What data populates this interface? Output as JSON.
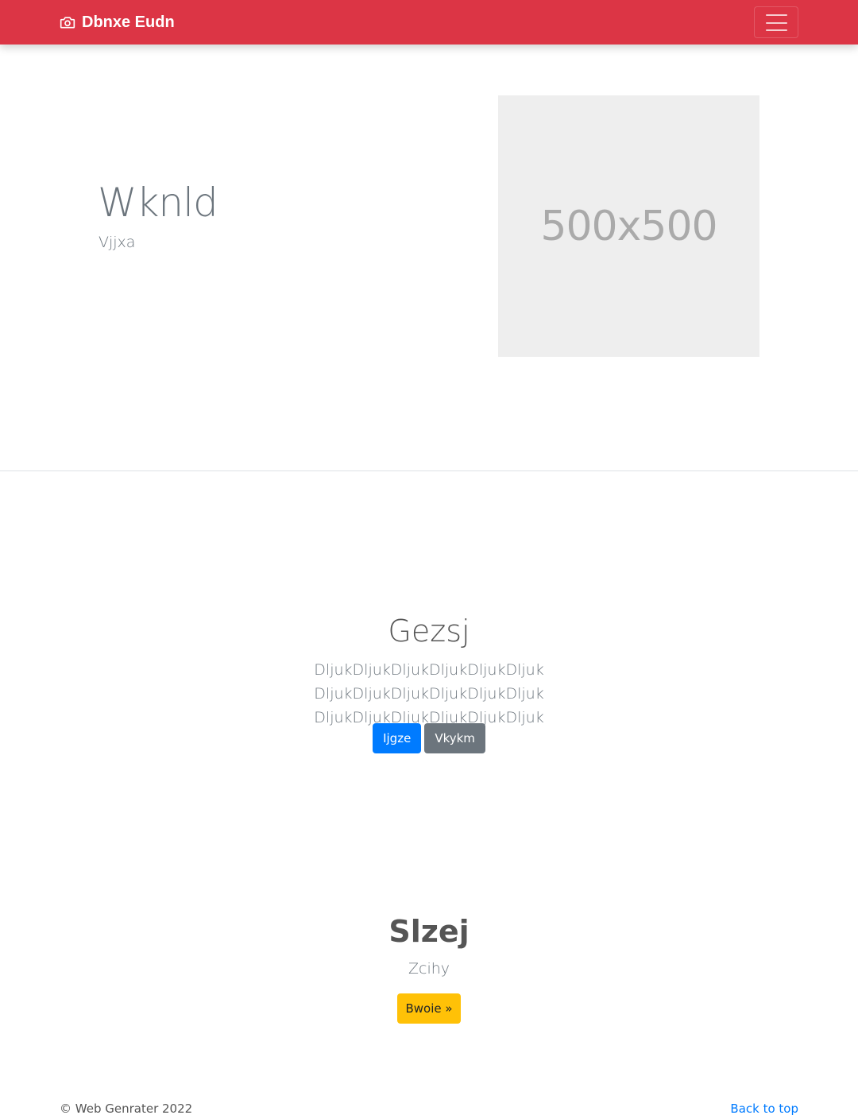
{
  "navbar": {
    "brand_icon": "camera-icon",
    "brand_text": "Dbnxe Eudn",
    "toggler_icon": "hamburger-menu-icon",
    "color": "#dc3545"
  },
  "hero": {
    "title": "Wknld",
    "subtitle": "Vjjxa",
    "image_placeholder_text": "500x500"
  },
  "feature": {
    "title": "Gezsj",
    "lead": "DljukDljukDljukDljukDljukDljuk DljukDljukDljukDljukDljukDljuk DljukDljukDljukDljukDljukDljuk",
    "primary_button": "Ijgze",
    "secondary_button": "Vkykm"
  },
  "cta": {
    "title": "Slzej",
    "subtitle": "Zcihy",
    "button": "Bwoie »"
  },
  "footer": {
    "copyright": "© Web Genrater 2022",
    "back_to_top": "Back to top"
  },
  "colors": {
    "primary": "#007bff",
    "secondary": "#6c757d",
    "warning": "#ffc107",
    "danger": "#dc3545"
  }
}
